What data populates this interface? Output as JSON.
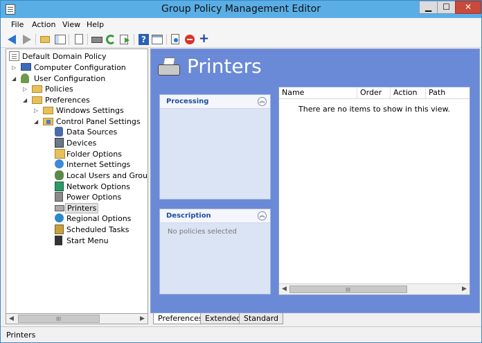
{
  "window": {
    "title": "Group Policy Management Editor"
  },
  "menu": [
    "File",
    "Action",
    "View",
    "Help"
  ],
  "toolbar": {
    "icons": [
      "back-arrow-icon",
      "forward-arrow-icon",
      "up-folder-icon",
      "show-hide-tree-icon",
      "properties-icon",
      "print-icon",
      "refresh-icon",
      "export-list-icon",
      "help-icon",
      "show-hide-action-pane-icon",
      "new-item-icon",
      "stop-icon",
      "add-icon"
    ]
  },
  "tree": {
    "items": [
      {
        "label": "Default Domain Policy",
        "level": 0
      },
      {
        "label": "Computer Configuration",
        "level": 1
      },
      {
        "label": "User Configuration",
        "level": 1
      },
      {
        "label": "Policies",
        "level": 2
      },
      {
        "label": "Preferences",
        "level": 2
      },
      {
        "label": "Windows Settings",
        "level": 3
      },
      {
        "label": "Control Panel Settings",
        "level": 3
      },
      {
        "label": "Data Sources",
        "level": 4
      },
      {
        "label": "Devices",
        "level": 4
      },
      {
        "label": "Folder Options",
        "level": 4
      },
      {
        "label": "Internet Settings",
        "level": 4
      },
      {
        "label": "Local Users and Groups",
        "level": 4
      },
      {
        "label": "Network Options",
        "level": 4
      },
      {
        "label": "Power Options",
        "level": 4
      },
      {
        "label": "Printers",
        "level": 4
      },
      {
        "label": "Regional Options",
        "level": 4
      },
      {
        "label": "Scheduled Tasks",
        "level": 4
      },
      {
        "label": "Start Menu",
        "level": 4
      }
    ],
    "selected": "Printers"
  },
  "header": {
    "title": "Printers"
  },
  "panels": {
    "processing": {
      "title": "Processing"
    },
    "description": {
      "title": "Description",
      "text": "No policies selected"
    }
  },
  "list": {
    "columns": [
      "Name",
      "Order",
      "Action",
      "Path"
    ],
    "empty_message": "There are no items to show in this view."
  },
  "tabs": [
    "Preferences",
    "Extended",
    "Standard"
  ],
  "active_tab": "Preferences",
  "status": {
    "text": "Printers"
  },
  "scrollbar": {
    "grip": "III"
  }
}
